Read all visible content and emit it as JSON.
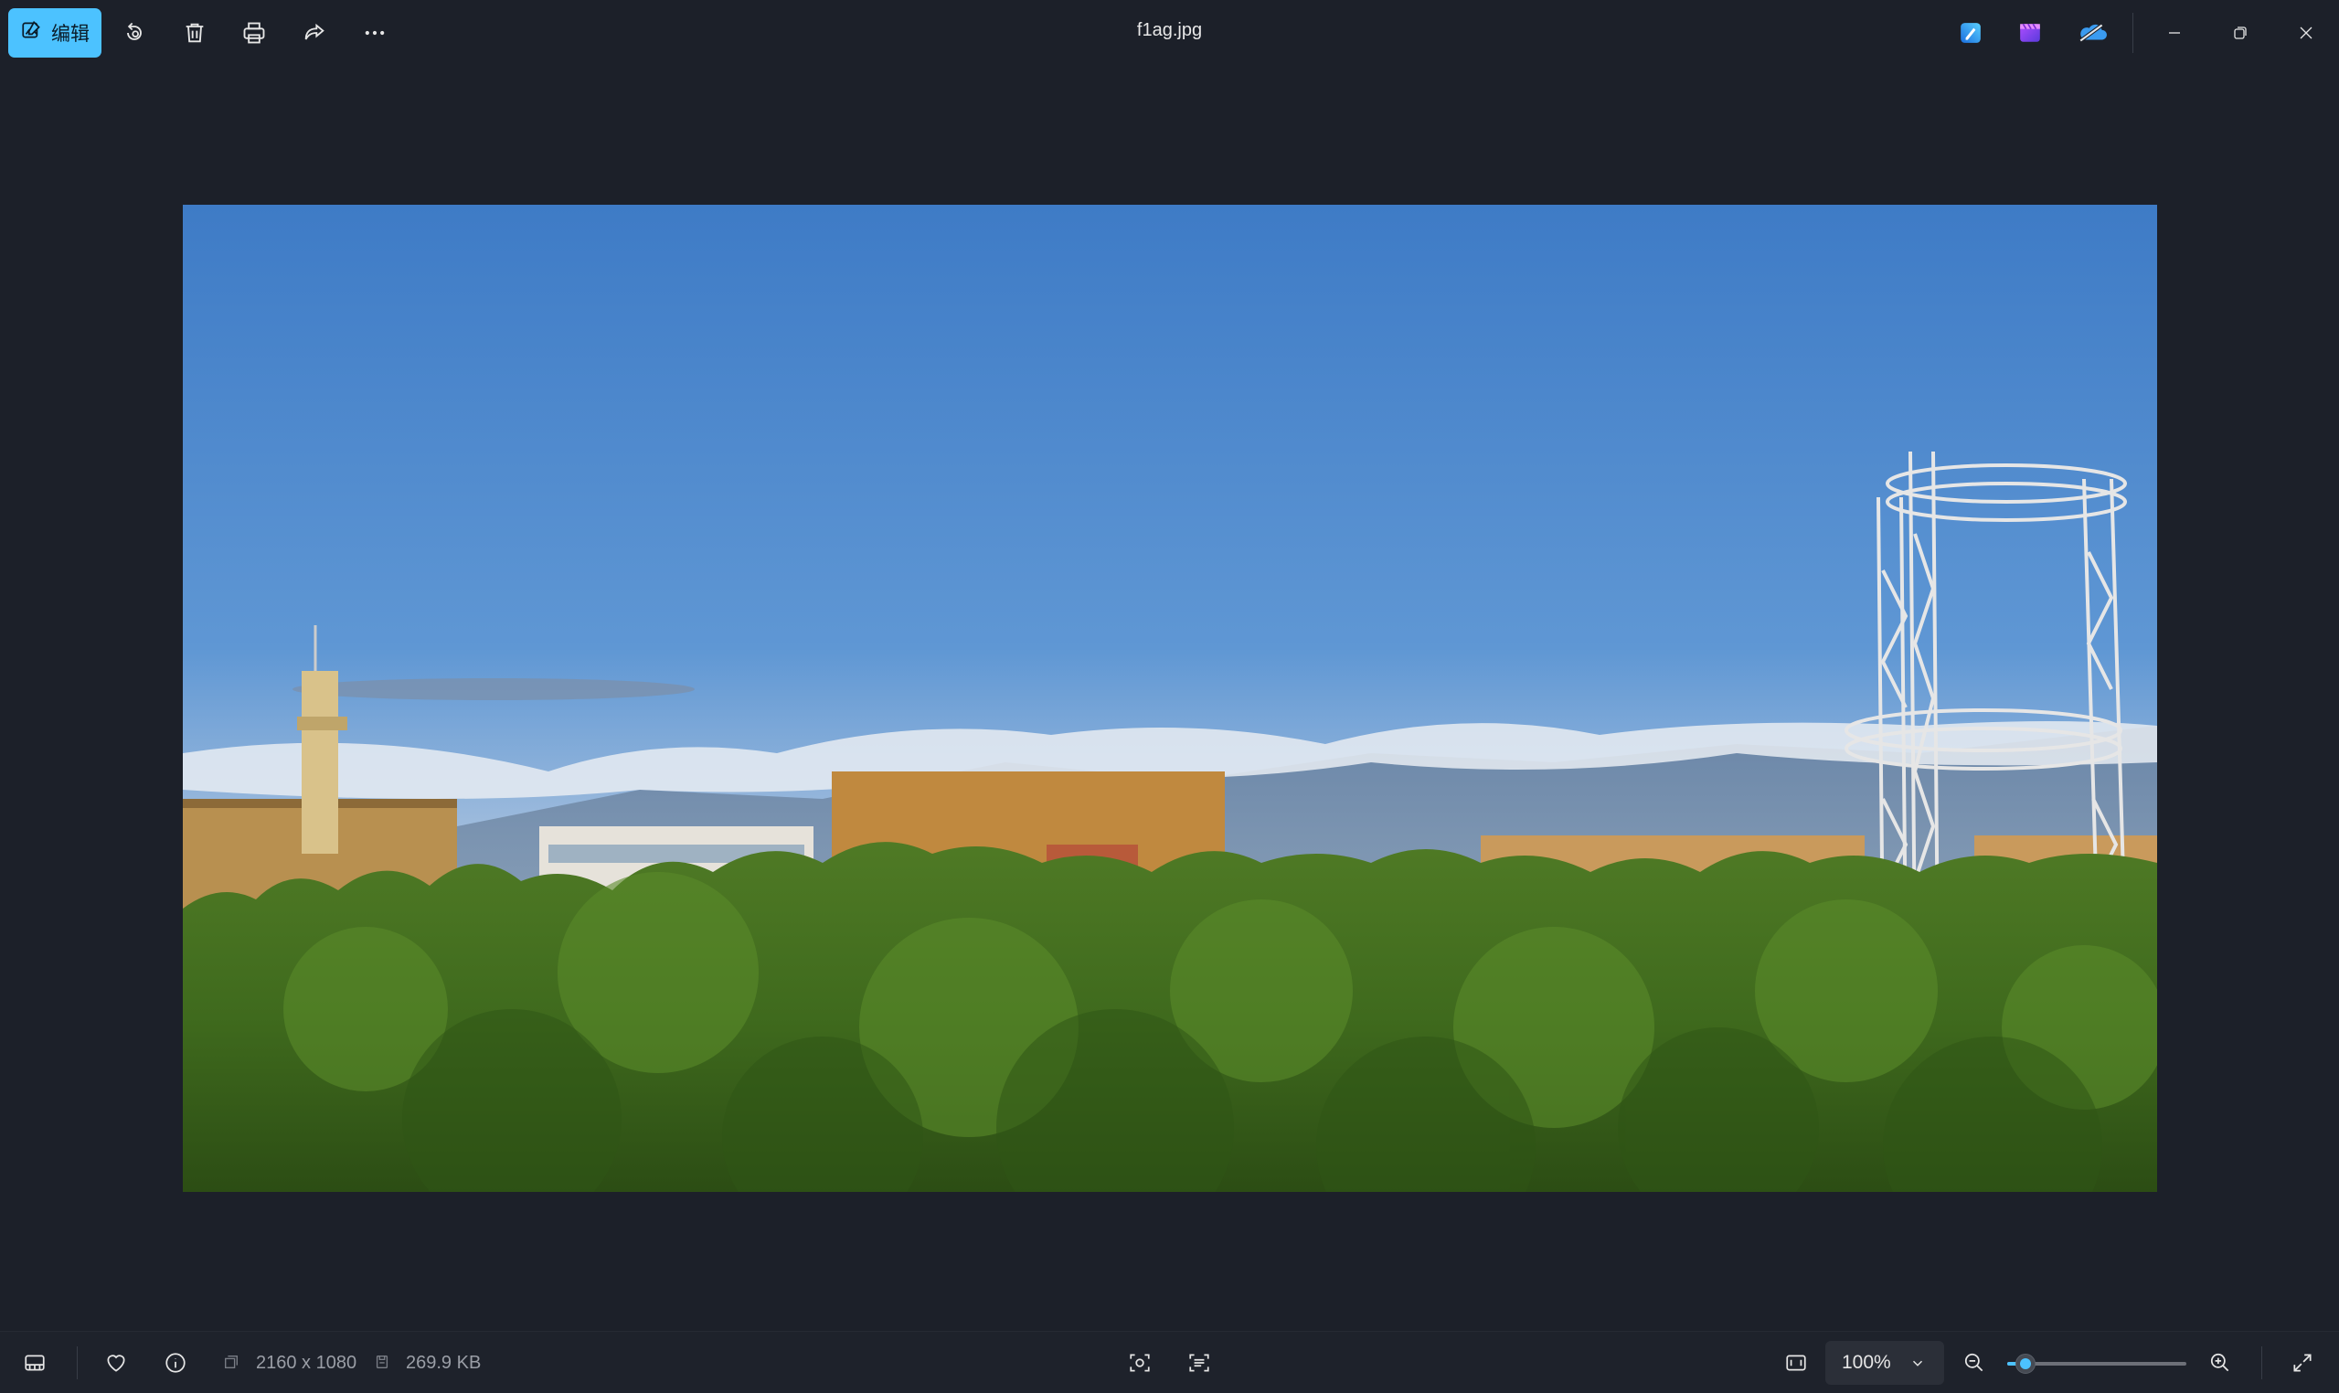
{
  "toolbar": {
    "edit_label": "编辑",
    "title": "f1ag.jpg",
    "icons": [
      "edit-icon",
      "rotate-icon",
      "delete-icon",
      "print-icon",
      "share-icon",
      "more-icon"
    ]
  },
  "app_icons": [
    "designer-icon",
    "clipchamp-icon",
    "onedrive-icon"
  ],
  "window_controls": [
    "minimize-icon",
    "restore-icon",
    "close-icon"
  ],
  "image": {
    "description_icons": [
      "photo"
    ]
  },
  "statusbar": {
    "dimensions": "2160 x 1080",
    "file_size": "269.9 KB",
    "zoom": "100%",
    "zoom_level": 0.1
  },
  "colors": {
    "accent": "#4cc2ff",
    "background": "#1c2029"
  }
}
